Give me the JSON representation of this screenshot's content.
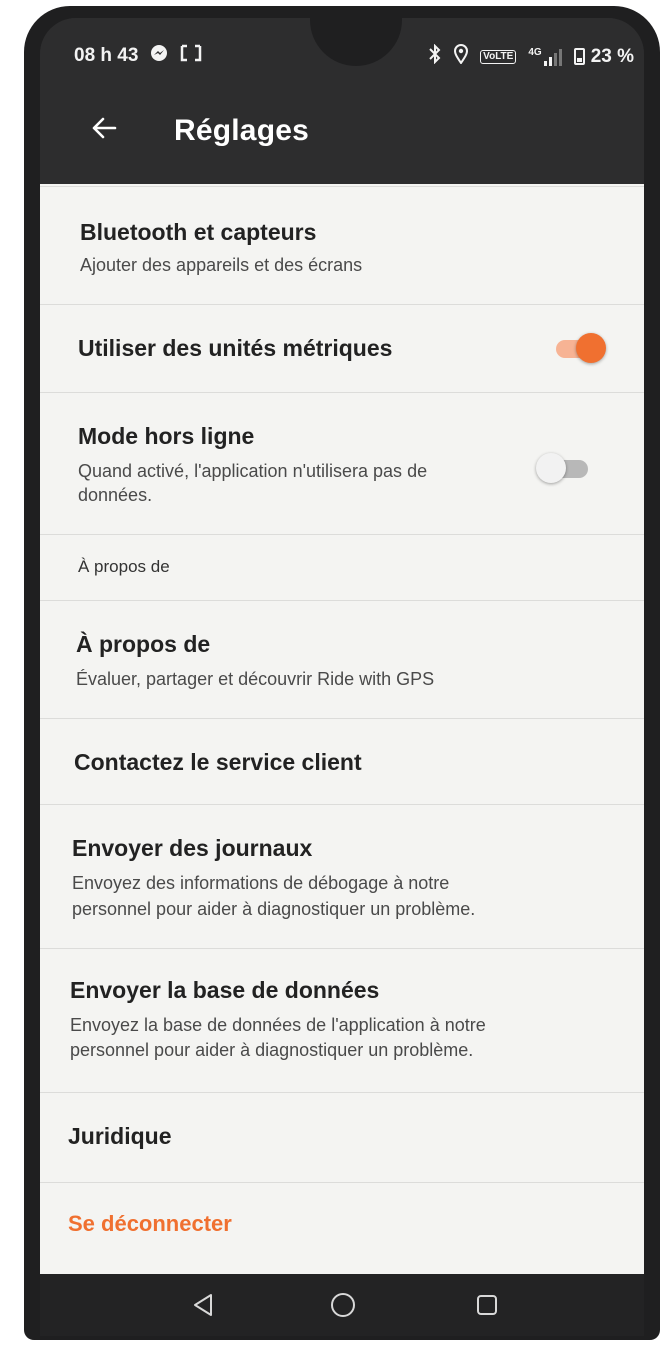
{
  "status_bar": {
    "time": "08 h 43",
    "network": "4G",
    "volte": "VoLTE",
    "battery": "23 %"
  },
  "app_bar": {
    "title": "Réglages",
    "back_icon": "arrow-left-icon"
  },
  "settings": {
    "bluetooth": {
      "title": "Bluetooth et capteurs",
      "subtitle": "Ajouter des appareils et des écrans"
    },
    "metric_units": {
      "title": "Utiliser des unités métriques",
      "enabled": true
    },
    "offline_mode": {
      "title": "Mode hors ligne",
      "subtitle_line1": "Quand activé, l'application n'utilisera pas de",
      "subtitle_line2": "données.",
      "enabled": false
    },
    "about_section": {
      "header": "À propos de"
    },
    "about": {
      "title": "À propos de",
      "subtitle": "Évaluer, partager et découvrir Ride with GPS"
    },
    "contact": {
      "title": "Contactez le service client"
    },
    "send_logs": {
      "title": "Envoyer des journaux",
      "subtitle_line1": "Envoyez des informations de débogage à notre",
      "subtitle_line2": "personnel pour aider à diagnostiquer un problème."
    },
    "send_database": {
      "title": "Envoyer la base de données",
      "subtitle_line1": "Envoyez la base de données de l'application à notre",
      "subtitle_line2": "personnel pour aider à diagnostiquer un problème."
    },
    "legal": {
      "title": "Juridique"
    },
    "logout": {
      "label": "Se déconnecter"
    }
  },
  "colors": {
    "accent": "#f07030",
    "accent_track": "#f7b394",
    "toggle_off_knob": "#f2f2f2",
    "toggle_off_track": "#b8b8b8",
    "app_bar": "#2d2d2e"
  },
  "nav_bar": {
    "back_icon": "triangle-back-icon",
    "home_icon": "circle-home-icon",
    "recents_icon": "square-recents-icon"
  }
}
